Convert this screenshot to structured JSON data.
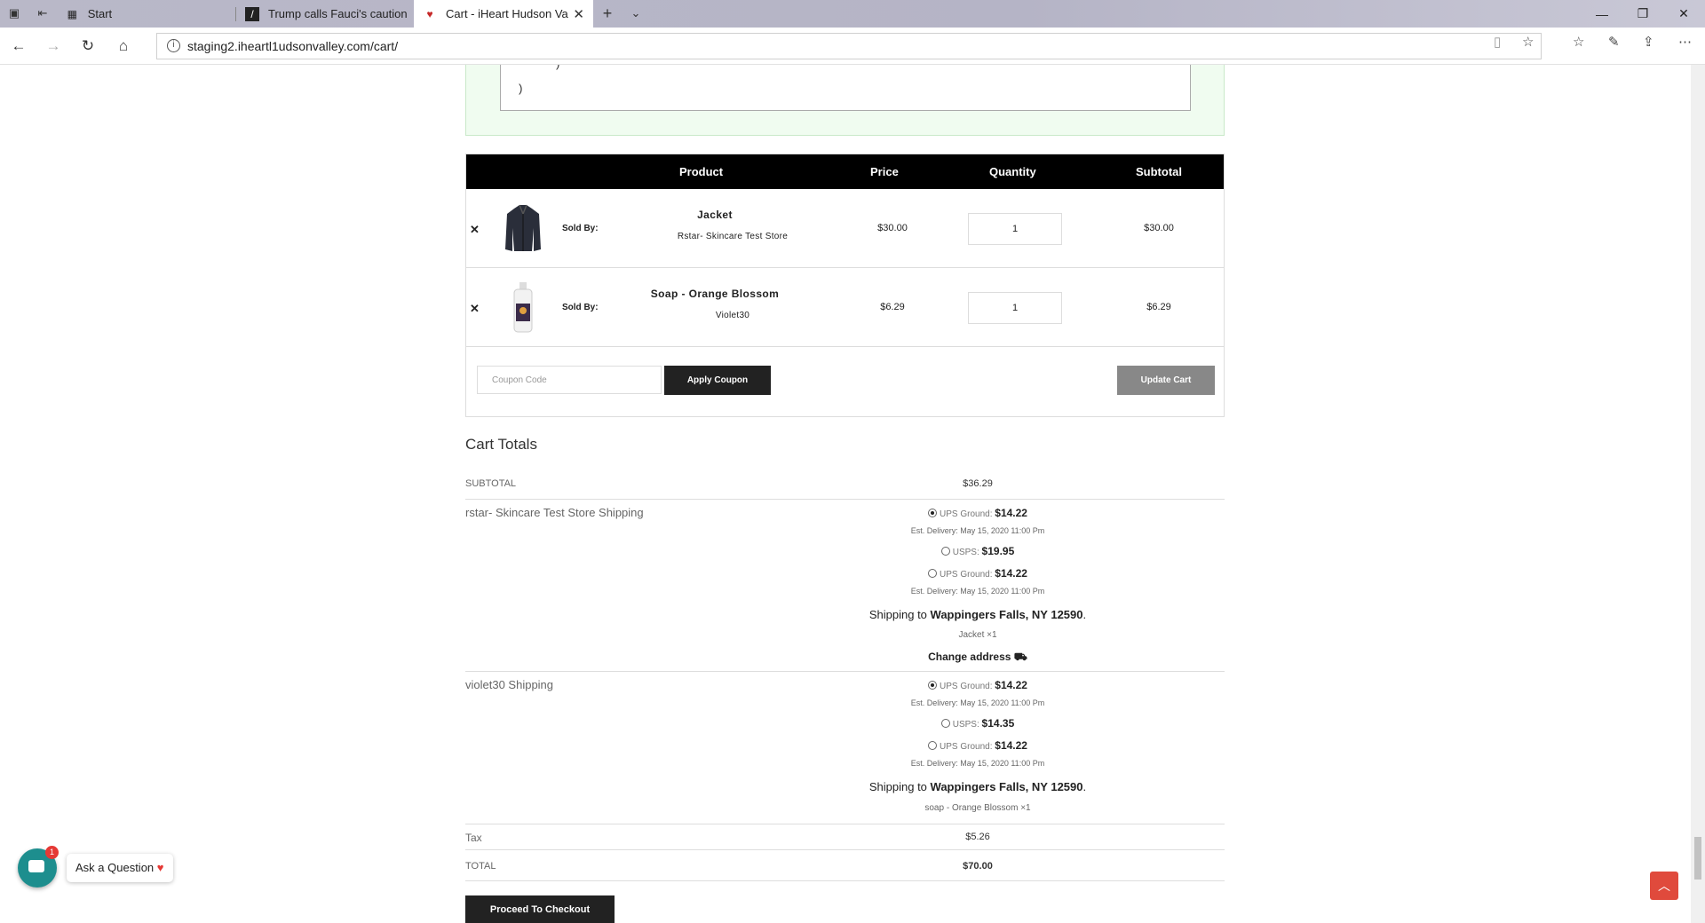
{
  "browser": {
    "tabs": [
      {
        "label": "Start"
      },
      {
        "label": "Trump calls Fauci's caution c"
      },
      {
        "label": "Cart - iHeart Hudson Va"
      }
    ],
    "url": "staging2.iheartl1udsonvalley.com/cart/"
  },
  "notice": {
    "code_line": ")"
  },
  "cart": {
    "headers": {
      "product": "Product",
      "price": "Price",
      "quantity": "Quantity",
      "subtotal": "Subtotal"
    },
    "items": [
      {
        "name": "Jacket",
        "sold_by_label": "Sold By:",
        "vendor": "Rstar- Skincare Test Store",
        "price": "$30.00",
        "quantity": "1",
        "subtotal": "$30.00",
        "thumb": "jacket-image"
      },
      {
        "name": "Soap - Orange Blossom",
        "sold_by_label": "Sold By:",
        "vendor": "Violet30",
        "price": "$6.29",
        "quantity": "1",
        "subtotal": "$6.29",
        "thumb": "soap-bottle-image"
      }
    ],
    "coupon_placeholder": "Coupon Code",
    "apply_label": "Apply Coupon",
    "update_label": "Update Cart"
  },
  "totals": {
    "title": "Cart Totals",
    "subtotal_label": "SUBTOTAL",
    "subtotal_value": "$36.29",
    "shipping1": {
      "label": "rstar- Skincare Test Store Shipping",
      "opt1_name": "UPS Ground:",
      "opt1_price": "$14.22",
      "opt1_est": "Est. Delivery: May 15, 2020 11:00 Pm",
      "opt2_name": "USPS:",
      "opt2_price": "$19.95",
      "opt3_name": "UPS Ground:",
      "opt3_price": "$14.22",
      "opt3_est": "Est. Delivery: May 15, 2020 11:00 Pm",
      "ship_to_prefix": "Shipping to ",
      "ship_to_place": "Wappingers Falls, NY 12590",
      "items": "Jacket ×1",
      "change_address": "Change address"
    },
    "shipping2": {
      "label": "violet30 Shipping",
      "opt1_name": "UPS Ground:",
      "opt1_price": "$14.22",
      "opt1_est": "Est. Delivery: May 15, 2020 11:00 Pm",
      "opt2_name": "USPS:",
      "opt2_price": "$14.35",
      "opt3_name": "UPS Ground:",
      "opt3_price": "$14.22",
      "opt3_est": "Est. Delivery: May 15, 2020 11:00 Pm",
      "ship_to_prefix": "Shipping to ",
      "ship_to_place": "Wappingers Falls, NY 12590",
      "items": "soap - Orange Blossom ×1"
    },
    "tax_label": "Tax",
    "tax_value": "$5.26",
    "total_label": "TOTAL",
    "total_value": "$70.00",
    "checkout_label": "Proceed To Checkout"
  },
  "chat": {
    "badge": "1",
    "label": "Ask a Question"
  },
  "colors": {
    "accent": "#1d8e8e",
    "totop": "#e04a3c"
  }
}
